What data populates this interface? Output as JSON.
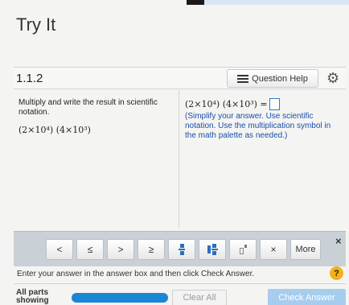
{
  "page": {
    "title": "Try It"
  },
  "header": {
    "section_number": "1.1.2",
    "help_label": "Question Help",
    "help_icon": "list-icon",
    "settings_icon": "gear-icon"
  },
  "question": {
    "prompt": "Multiply and write the result in scientific notation.",
    "expression": "(2×10⁴) (4×10³)",
    "answer_expression": "(2×10⁴) (4×10³) =",
    "answer_value": "",
    "hint": "(Simplify your answer. Use scientific notation. Use the multiplication symbol in the math palette as needed.)"
  },
  "palette": {
    "buttons": [
      "<",
      "≤",
      ">",
      "≥",
      "fraction",
      "mixed-number",
      "exponent",
      "×",
      "More"
    ],
    "close_label": "×"
  },
  "footer": {
    "instruction": "Enter your answer in the answer box and then click Check Answer.",
    "help_symbol": "?",
    "parts_label": "All parts showing",
    "progress_fraction": 1.0,
    "clear_label": "Clear All",
    "check_label": "Check Answer"
  },
  "colors": {
    "accent": "#1a86d6",
    "check_button_disabled": "#a7cdee",
    "hint_text": "#1a4fa8",
    "help_badge": "#f2b21a"
  }
}
